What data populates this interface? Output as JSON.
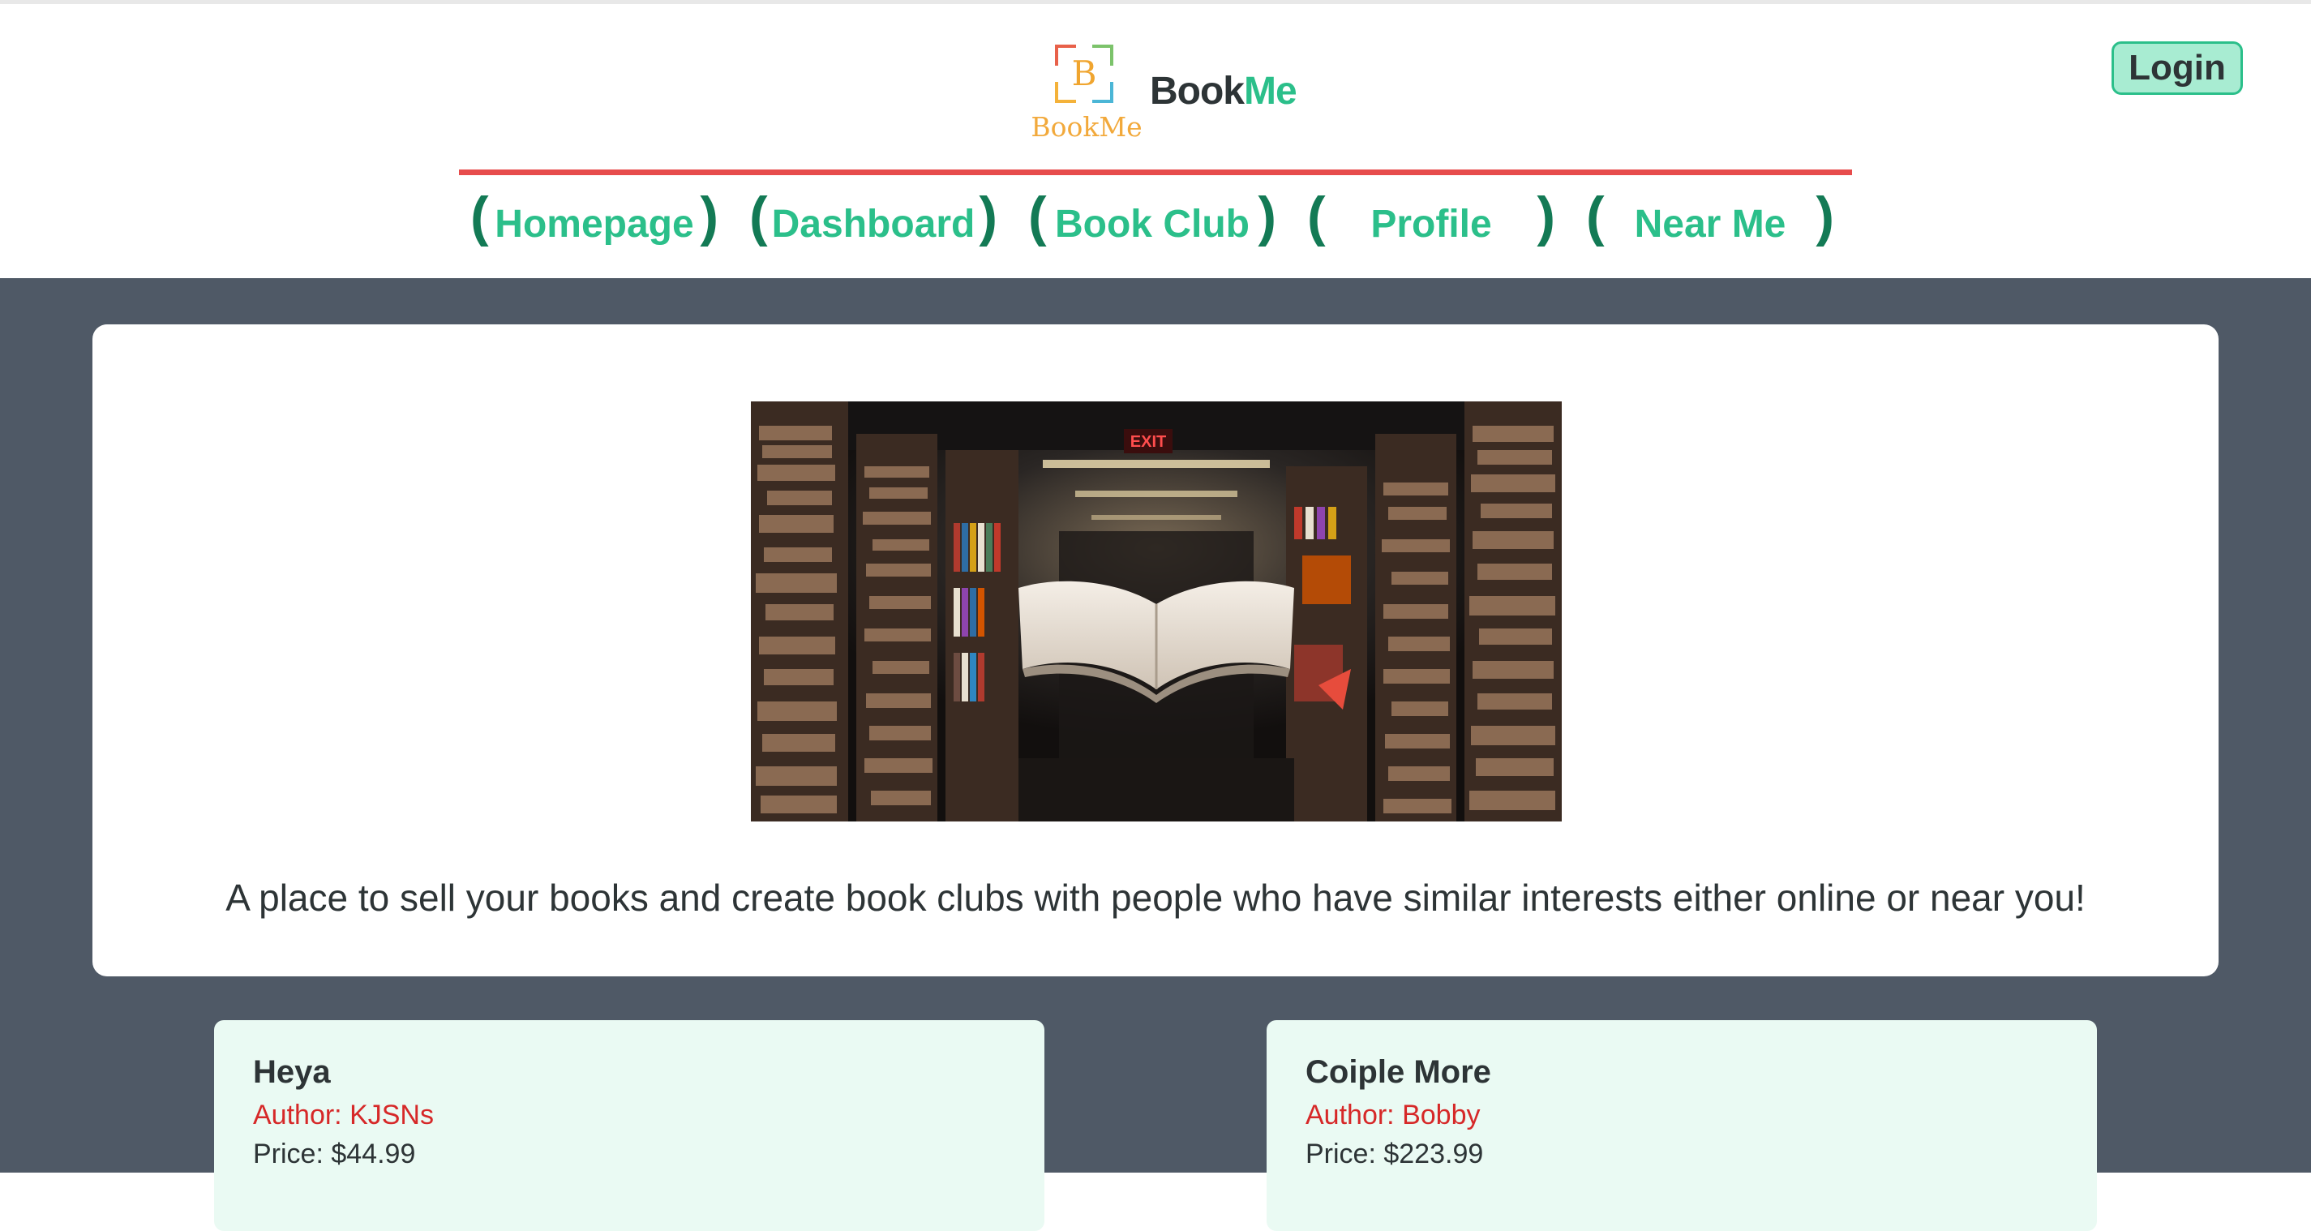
{
  "brand": {
    "logo_letter": "B",
    "logo_caption": "BookMe",
    "name_part1": "Book",
    "name_part2": "Me"
  },
  "header": {
    "login_label": "Login"
  },
  "nav": {
    "paren_open": "(",
    "paren_close": ")",
    "items": [
      {
        "label": "Homepage"
      },
      {
        "label": "Dashboard"
      },
      {
        "label": "Book Club"
      },
      {
        "label": "Profile"
      },
      {
        "label": "Near Me"
      }
    ]
  },
  "hero": {
    "tagline": "A place to sell your books and create book clubs with people who have similar interests either online or near you!",
    "image_sign": "EXIT"
  },
  "books": [
    {
      "title": "Heya",
      "author": "Author: KJSNs",
      "price": "Price: $44.99"
    },
    {
      "title": "Coiple More",
      "author": "Author: Bobby",
      "price": "Price: $223.99"
    }
  ],
  "colors": {
    "accent": "#2bbf8a",
    "accent_dark": "#137a55",
    "nav_line": "#e74c4c",
    "page_bg": "#4f5966",
    "author_text": "#d62828",
    "card_bg": "#eafaf3"
  }
}
